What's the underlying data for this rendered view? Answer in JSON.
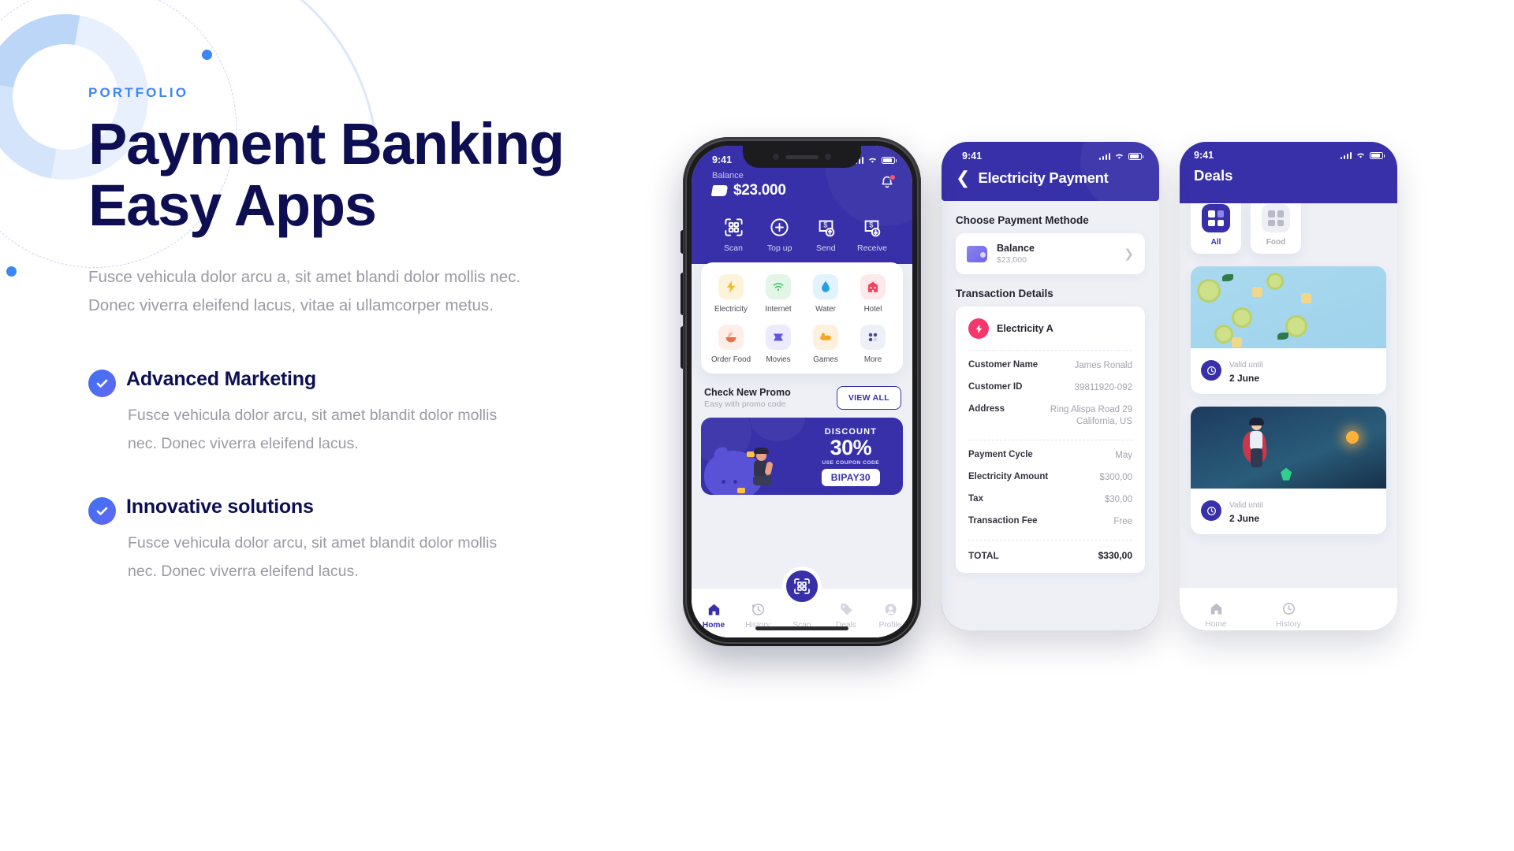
{
  "hero": {
    "eyebrow": "PORTFOLIO",
    "title_line1": "Payment Banking",
    "title_line2": "Easy Apps",
    "lede": "Fusce vehicula dolor arcu a, sit amet blandi dolor mollis nec. Donec viverra eleifend lacus, vitae ai ullamcorper metus.",
    "accent_color": "#3d86f5",
    "title_color": "#0d0f52",
    "features": [
      {
        "title": "Advanced Marketing",
        "body": "Fusce vehicula dolor arcu, sit amet blandit dolor mollis nec. Donec viverra eleifend lacus."
      },
      {
        "title": "Innovative solutions",
        "body": "Fusce vehicula dolor arcu, sit amet blandit dolor mollis nec. Donec viverra eleifend lacus."
      }
    ]
  },
  "phone1": {
    "status_time": "9:41",
    "balance_label": "Balance",
    "balance_amount": "$23.000",
    "quick_actions": [
      {
        "label": "Scan",
        "icon": "qr-scan-icon"
      },
      {
        "label": "Top up",
        "icon": "plus-circle-icon"
      },
      {
        "label": "Send",
        "icon": "send-money-icon"
      },
      {
        "label": "Receive",
        "icon": "receive-money-icon"
      }
    ],
    "services": [
      {
        "label": "Electricity",
        "icon": "bolt-icon",
        "bg": "#fdf3da",
        "color": "#f5b82e"
      },
      {
        "label": "Internet",
        "icon": "wifi-icon",
        "bg": "#e3f5e6",
        "color": "#3fbf63"
      },
      {
        "label": "Water",
        "icon": "water-drop-icon",
        "bg": "#e1f3fd",
        "color": "#27a0e0"
      },
      {
        "label": "Hotel",
        "icon": "hotel-icon",
        "bg": "#fde8ea",
        "color": "#f2405a"
      },
      {
        "label": "Order Food",
        "icon": "noodles-icon",
        "bg": "#fdeee8",
        "color": "#e8734a"
      },
      {
        "label": "Movies",
        "icon": "ticket-icon",
        "bg": "#ecebfd",
        "color": "#5f57e0"
      },
      {
        "label": "Games",
        "icon": "gamepad-icon",
        "bg": "#fdf0dd",
        "color": "#f5a623"
      },
      {
        "label": "More",
        "icon": "grid-dots-icon",
        "bg": "#eef0f8",
        "color": "#4b4b8f"
      }
    ],
    "promo": {
      "title": "Check New Promo",
      "subtitle": "Easy with promo code",
      "view_all": "VIEW ALL",
      "banner_label": "DISCOUNT",
      "banner_value": "30%",
      "banner_hint": "USE COUPON CODE",
      "banner_code": "BIPAY30"
    },
    "tabs": [
      {
        "label": "Home",
        "icon": "home-icon",
        "active": true
      },
      {
        "label": "History",
        "icon": "history-icon",
        "active": false
      },
      {
        "label": "Scan",
        "icon": "qr-scan-icon",
        "active": false
      },
      {
        "label": "Deals",
        "icon": "tag-icon",
        "active": false
      },
      {
        "label": "Profile",
        "icon": "person-icon",
        "active": false
      }
    ]
  },
  "phone2": {
    "status_time": "9:41",
    "title": "Electricity Payment",
    "section_method": "Choose Payment Methode",
    "method": {
      "name": "Balance",
      "amount": "$23,000",
      "icon": "wallet-icon",
      "arrow": "chevron-right-icon"
    },
    "section_details": "Transaction Details",
    "provider": "Electricity A",
    "rows_primary": [
      {
        "key": "Customer Name",
        "value": "James Ronald"
      },
      {
        "key": "Customer ID",
        "value": "39811920-092"
      },
      {
        "key": "Address",
        "value": "Ring Alispa Road 29 California, US"
      }
    ],
    "rows_secondary": [
      {
        "key": "Payment Cycle",
        "value": "May"
      },
      {
        "key": "Electricity Amount",
        "value": "$300,00"
      },
      {
        "key": "Tax",
        "value": "$30,00"
      },
      {
        "key": "Transaction Fee",
        "value": "Free"
      }
    ],
    "total": {
      "key": "TOTAL",
      "value": "$330,00"
    }
  },
  "phone3": {
    "status_time": "9:41",
    "title": "Deals",
    "categories": [
      {
        "label": "All",
        "icon": "grid-icon",
        "active": true
      },
      {
        "label": "Food",
        "icon": "grid-icon",
        "active": false
      }
    ],
    "deals": [
      {
        "valid_label": "Valid until",
        "valid_date": "2 June",
        "image": "lime-fruit-photo"
      },
      {
        "valid_label": "Valid until",
        "valid_date": "2 June",
        "image": "game-character-photo"
      }
    ],
    "tabs": [
      {
        "label": "Home",
        "icon": "home-icon"
      },
      {
        "label": "History",
        "icon": "history-icon"
      }
    ]
  }
}
